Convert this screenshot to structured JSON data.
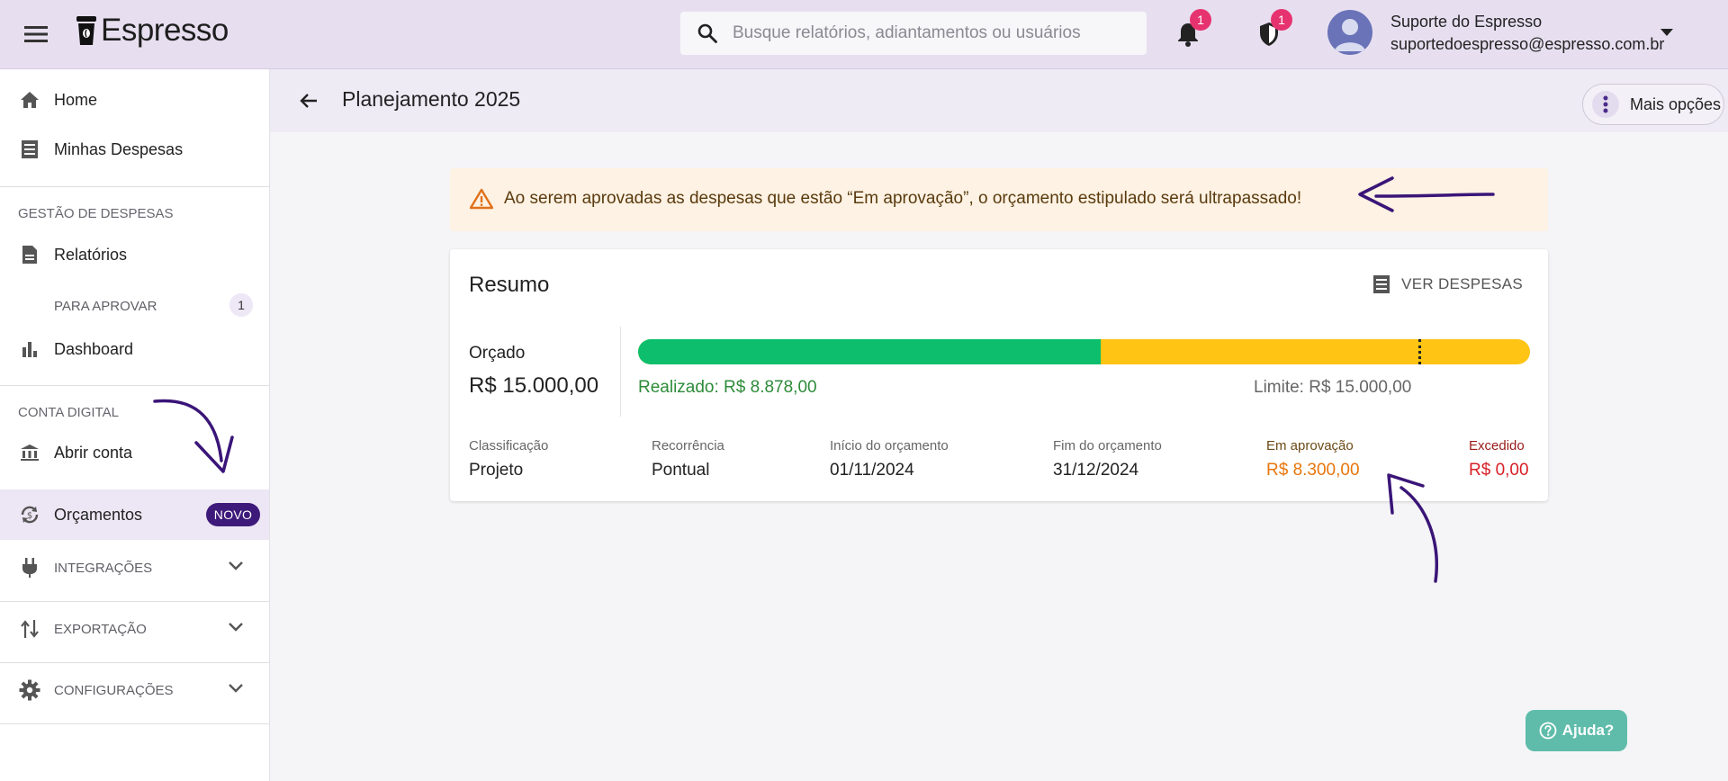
{
  "header": {
    "brand": "Espresso",
    "search_placeholder": "Busque relatórios, adiantamentos ou usuários",
    "notifications_count": "1",
    "security_count": "1",
    "user_name": "Suporte do Espresso",
    "user_email": "suportedoespresso@espresso.com.br"
  },
  "sidebar": {
    "home": "Home",
    "minhas_despesas": "Minhas Despesas",
    "section_gestao": "GESTÃO DE DESPESAS",
    "relatorios": "Relatórios",
    "para_aprovar": "PARA APROVAR",
    "para_aprovar_count": "1",
    "dashboard": "Dashboard",
    "section_conta": "CONTA DIGITAL",
    "abrir_conta": "Abrir conta",
    "orcamentos": "Orçamentos",
    "novo_badge": "NOVO",
    "integracoes": "INTEGRAÇÕES",
    "exportacao": "EXPORTAÇÃO",
    "configuracoes": "CONFIGURAÇÕES"
  },
  "page": {
    "title": "Planejamento 2025",
    "more_options": "Mais opções",
    "alert_text": "Ao serem aprovadas as despesas que estão “Em aprovação”, o orçamento estipulado será ultrapassado!"
  },
  "summary": {
    "title": "Resumo",
    "ver_despesas": "VER DESPESAS",
    "orcado_label": "Orçado",
    "orcado_value": "R$ 15.000,00",
    "realizado_text": "Realizado: R$ 8.878,00",
    "limite_text": "Limite: R$ 15.000,00",
    "progress": {
      "realizado_fraction": 0.5185,
      "limit_fraction": 0.875
    },
    "colors": {
      "realizado": "#0dbf6c",
      "em_aprovacao": "#ffc414"
    },
    "fields": {
      "classificacao_label": "Classificação",
      "classificacao_value": "Projeto",
      "recorrencia_label": "Recorrência",
      "recorrencia_value": "Pontual",
      "inicio_label": "Início do orçamento",
      "inicio_value": "01/11/2024",
      "fim_label": "Fim do orçamento",
      "fim_value": "31/12/2024",
      "em_aprovacao_label": "Em aprovação",
      "em_aprovacao_value": "R$ 8.300,00",
      "excedido_label": "Excedido",
      "excedido_value": "R$ 0,00"
    }
  },
  "help": {
    "label": "Ajuda?"
  },
  "icons": [
    "menu-icon",
    "coffee-cup-icon",
    "search-icon",
    "bell-icon",
    "shield-icon",
    "avatar-icon",
    "caret-down-icon",
    "home-icon",
    "list-icon",
    "document-icon",
    "bar-chart-icon",
    "bank-icon",
    "budget-icon",
    "plug-icon",
    "export-icon",
    "gear-icon",
    "chevron-down-icon",
    "arrow-back-icon",
    "more-vert-icon",
    "warning-icon",
    "help-icon"
  ]
}
